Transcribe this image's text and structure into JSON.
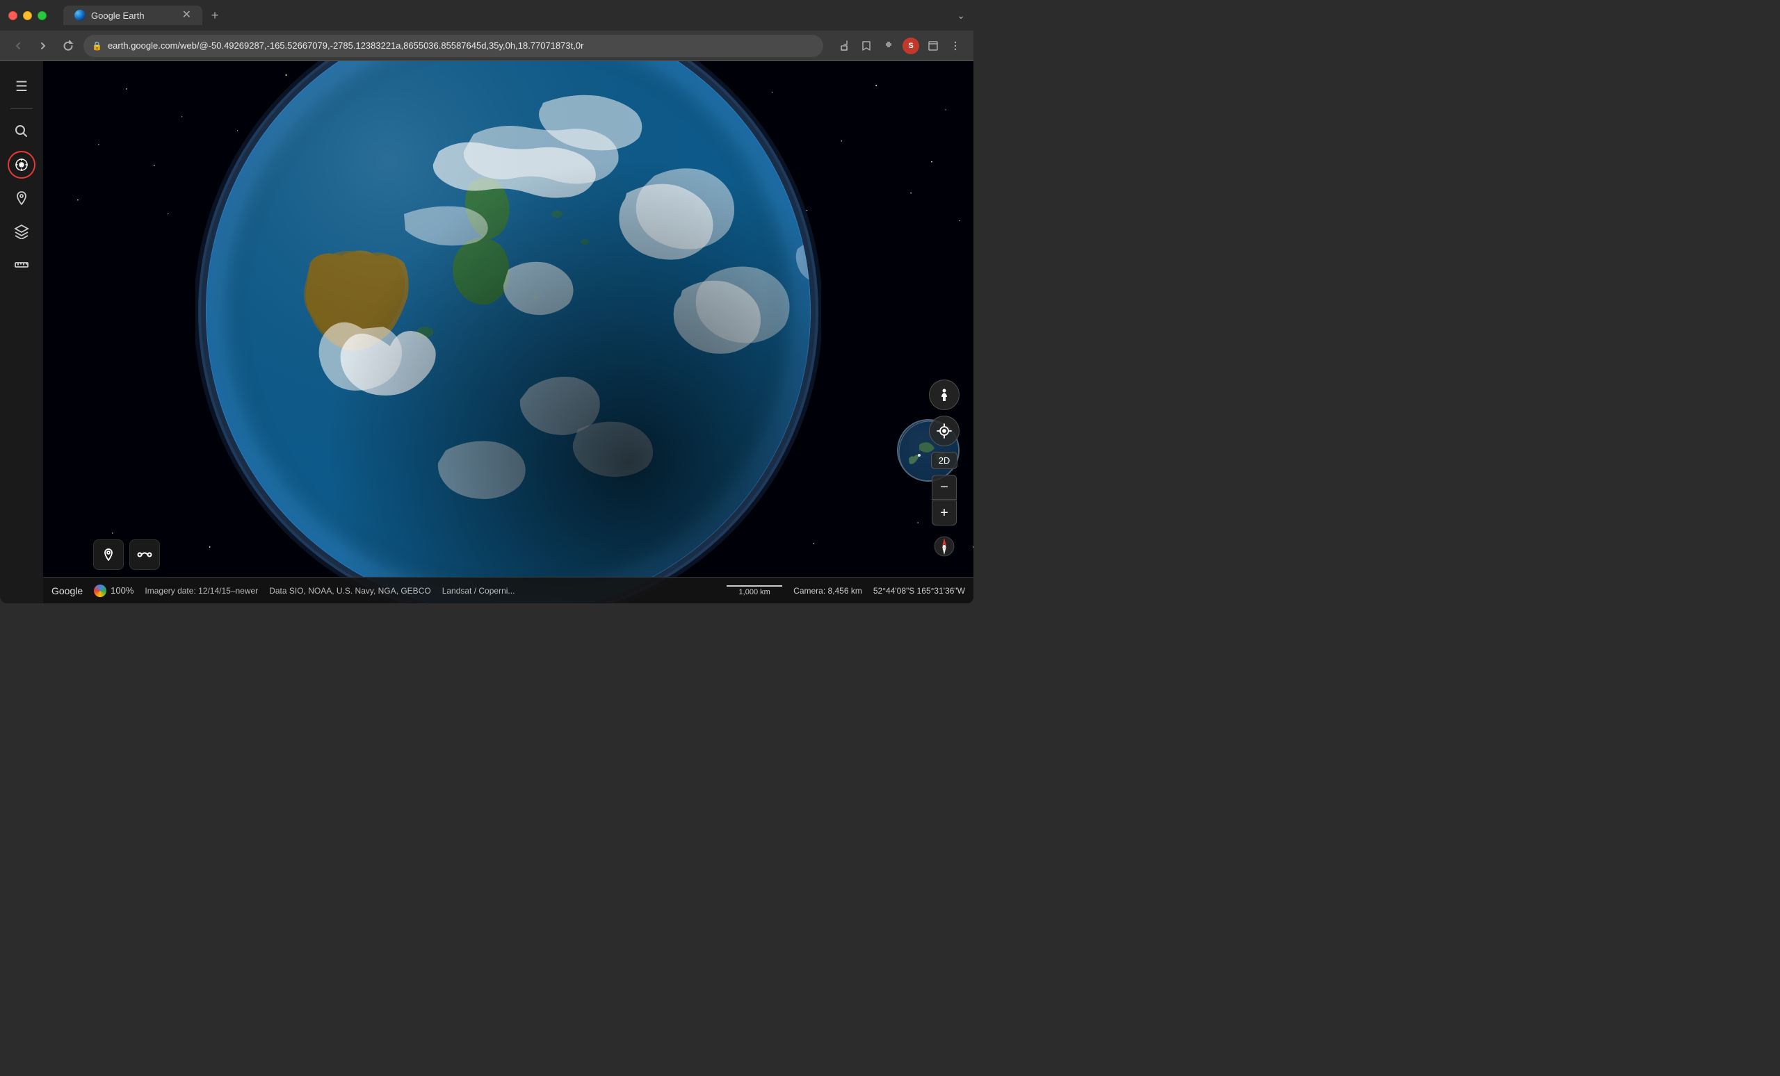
{
  "browser": {
    "tab_title": "Google Earth",
    "url": "earth.google.com/web/@-50.49269287,-165.52667079,-2785.12383221a,8655036.85587645d,35y,0h,18.77071873t,0r",
    "url_full": "earth.google.com/web/@-50.49269287,-165.52667079,-2785.12383221a,8655036.85587645d,35y,0h,18.77071873t,0r",
    "new_tab_label": "+",
    "nav": {
      "back": "‹",
      "forward": "›",
      "refresh": "↻"
    }
  },
  "sidebar": {
    "menu_icon": "☰",
    "search_icon": "⌕",
    "voyager_icon": "✦",
    "places_icon": "◎",
    "layers_icon": "⊞",
    "measure_icon": "⊟"
  },
  "bottom_toolbar": {
    "location_pin_icon": "📍",
    "route_icon": "···"
  },
  "right_controls": {
    "street_view_label": "👤",
    "locate_label": "◎",
    "view_2d": "2D",
    "zoom_minus": "−",
    "zoom_plus": "+",
    "compass_label": "▲"
  },
  "status_bar": {
    "google_label": "Google",
    "loading_percent": "100%",
    "imagery_date": "Imagery date: 12/14/15–newer",
    "data_attribution": "Data SIO, NOAA, U.S. Navy, NGA, GEBCO",
    "imagery_attribution": "Landsat / Coperni...",
    "scale_label": "1,000 km",
    "camera_label": "Camera: 8,456 km",
    "coords": "52°44'08\"S 165°31'36\"W"
  }
}
